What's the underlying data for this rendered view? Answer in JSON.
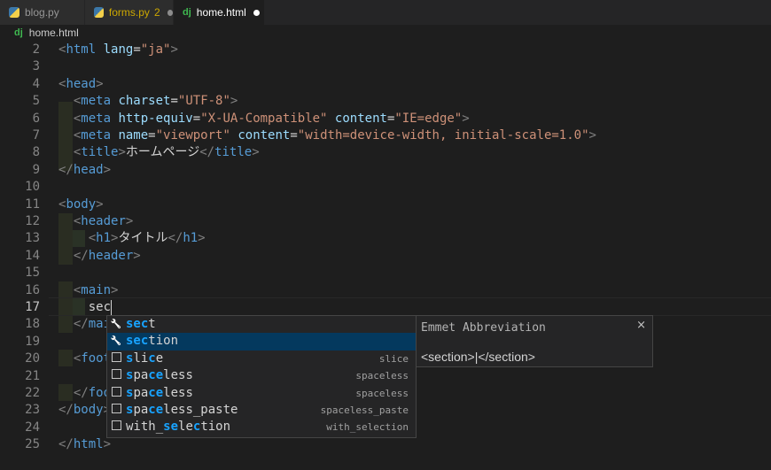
{
  "tabs": [
    {
      "label": "blog.py",
      "icon": "python-icon",
      "state": "inactive"
    },
    {
      "label": "forms.py",
      "badge": "2",
      "icon": "python-icon",
      "state": "inactive",
      "modified": true
    },
    {
      "label": "home.html",
      "icon": "django-icon",
      "state": "active",
      "modified": true
    }
  ],
  "breadcrumb": {
    "icon_text": "dj",
    "file": "home.html"
  },
  "tab_icon_text": "dj",
  "lines": [
    {
      "n": "2",
      "parts": [
        [
          "t",
          "<"
        ],
        [
          "tg",
          "html"
        ],
        [
          "tx",
          " "
        ],
        [
          "at",
          "lang"
        ],
        [
          "tx",
          "="
        ],
        [
          "st",
          "\"ja\""
        ],
        [
          "t",
          ">"
        ]
      ]
    },
    {
      "n": "3",
      "parts": []
    },
    {
      "n": "4",
      "parts": [
        [
          "t",
          "<"
        ],
        [
          "tg",
          "head"
        ],
        [
          "t",
          ">"
        ]
      ]
    },
    {
      "n": "5",
      "parts": [
        [
          "tx",
          "  "
        ],
        [
          "t",
          "<"
        ],
        [
          "tg",
          "meta"
        ],
        [
          "tx",
          " "
        ],
        [
          "at",
          "charset"
        ],
        [
          "tx",
          "="
        ],
        [
          "st",
          "\"UTF-8\""
        ],
        [
          "t",
          ">"
        ]
      ]
    },
    {
      "n": "6",
      "parts": [
        [
          "tx",
          "  "
        ],
        [
          "t",
          "<"
        ],
        [
          "tg",
          "meta"
        ],
        [
          "tx",
          " "
        ],
        [
          "at",
          "http-equiv"
        ],
        [
          "tx",
          "="
        ],
        [
          "st",
          "\"X-UA-Compatible\""
        ],
        [
          "tx",
          " "
        ],
        [
          "at",
          "content"
        ],
        [
          "tx",
          "="
        ],
        [
          "st",
          "\"IE=edge\""
        ],
        [
          "t",
          ">"
        ]
      ]
    },
    {
      "n": "7",
      "parts": [
        [
          "tx",
          "  "
        ],
        [
          "t",
          "<"
        ],
        [
          "tg",
          "meta"
        ],
        [
          "tx",
          " "
        ],
        [
          "at",
          "name"
        ],
        [
          "tx",
          "="
        ],
        [
          "st",
          "\"viewport\""
        ],
        [
          "tx",
          " "
        ],
        [
          "at",
          "content"
        ],
        [
          "tx",
          "="
        ],
        [
          "st",
          "\"width=device-width, initial-scale=1.0\""
        ],
        [
          "t",
          ">"
        ]
      ]
    },
    {
      "n": "8",
      "parts": [
        [
          "tx",
          "  "
        ],
        [
          "t",
          "<"
        ],
        [
          "tg",
          "title"
        ],
        [
          "t",
          ">"
        ],
        [
          "tx",
          "ホームページ"
        ],
        [
          "t",
          "</"
        ],
        [
          "tg",
          "title"
        ],
        [
          "t",
          ">"
        ]
      ]
    },
    {
      "n": "9",
      "parts": [
        [
          "t",
          "</"
        ],
        [
          "tg",
          "head"
        ],
        [
          "t",
          ">"
        ]
      ]
    },
    {
      "n": "10",
      "parts": []
    },
    {
      "n": "11",
      "parts": [
        [
          "t",
          "<"
        ],
        [
          "tg",
          "body"
        ],
        [
          "t",
          ">"
        ]
      ]
    },
    {
      "n": "12",
      "parts": [
        [
          "tx",
          "  "
        ],
        [
          "t",
          "<"
        ],
        [
          "tg",
          "header"
        ],
        [
          "t",
          ">"
        ]
      ]
    },
    {
      "n": "13",
      "parts": [
        [
          "tx",
          "    "
        ],
        [
          "t",
          "<"
        ],
        [
          "tg",
          "h1"
        ],
        [
          "t",
          ">"
        ],
        [
          "tx",
          "タイトル"
        ],
        [
          "t",
          "</"
        ],
        [
          "tg",
          "h1"
        ],
        [
          "t",
          ">"
        ]
      ]
    },
    {
      "n": "14",
      "parts": [
        [
          "tx",
          "  "
        ],
        [
          "t",
          "</"
        ],
        [
          "tg",
          "header"
        ],
        [
          "t",
          ">"
        ]
      ]
    },
    {
      "n": "15",
      "parts": []
    },
    {
      "n": "16",
      "parts": [
        [
          "tx",
          "  "
        ],
        [
          "t",
          "<"
        ],
        [
          "tg",
          "main"
        ],
        [
          "t",
          ">"
        ]
      ]
    },
    {
      "n": "17",
      "parts": [
        [
          "tx",
          "    sec"
        ]
      ],
      "current": true
    },
    {
      "n": "18",
      "parts": [
        [
          "tx",
          "  "
        ],
        [
          "t",
          "</"
        ],
        [
          "tg",
          "mai"
        ]
      ]
    },
    {
      "n": "19",
      "parts": []
    },
    {
      "n": "20",
      "parts": [
        [
          "tx",
          "  "
        ],
        [
          "t",
          "<"
        ],
        [
          "tg",
          "foot"
        ]
      ]
    },
    {
      "n": "21",
      "parts": []
    },
    {
      "n": "22",
      "parts": [
        [
          "tx",
          "  "
        ],
        [
          "t",
          "</"
        ],
        [
          "tg",
          "foo"
        ]
      ]
    },
    {
      "n": "23",
      "parts": [
        [
          "t",
          "</"
        ],
        [
          "tg",
          "body"
        ],
        [
          "t",
          ">"
        ]
      ]
    },
    {
      "n": "24",
      "parts": []
    },
    {
      "n": "25",
      "parts": [
        [
          "t",
          "</"
        ],
        [
          "tg",
          "html"
        ],
        [
          "t",
          ">"
        ]
      ]
    }
  ],
  "suggestions": [
    {
      "icon": "wrench-icon",
      "match": "sec",
      "rest": "t",
      "detail": "",
      "selected": false
    },
    {
      "icon": "wrench-icon",
      "match": "sec",
      "rest": "tion",
      "detail": "",
      "selected": true
    },
    {
      "icon": "snippet-icon",
      "label_html": [
        [
          "hl",
          "s"
        ],
        [
          "",
          "li"
        ],
        [
          "hl",
          "c"
        ],
        [
          "",
          "e"
        ]
      ],
      "detail": "slice",
      "selected": false
    },
    {
      "icon": "snippet-icon",
      "label_html": [
        [
          "hl",
          "s"
        ],
        [
          "",
          "pa"
        ],
        [
          "hl",
          "ce"
        ],
        [
          "",
          "less"
        ]
      ],
      "detail": "spaceless",
      "selected": false
    },
    {
      "icon": "snippet-icon",
      "label_html": [
        [
          "hl",
          "s"
        ],
        [
          "",
          "pa"
        ],
        [
          "hl",
          "ce"
        ],
        [
          "",
          "less"
        ]
      ],
      "detail": "spaceless",
      "selected": false
    },
    {
      "icon": "snippet-icon",
      "label_html": [
        [
          "hl",
          "s"
        ],
        [
          "",
          "pa"
        ],
        [
          "hl",
          "ce"
        ],
        [
          "",
          "less_paste"
        ]
      ],
      "detail": "spaceless_paste",
      "selected": false
    },
    {
      "icon": "snippet-icon",
      "label_html": [
        [
          "",
          "with_"
        ],
        [
          "hl",
          "se"
        ],
        [
          "",
          "le"
        ],
        [
          "hl",
          "c"
        ],
        [
          "",
          "tion"
        ]
      ],
      "detail": "with_selection",
      "selected": false
    }
  ],
  "docs": {
    "title": "Emmet Abbreviation",
    "close": "×",
    "body": "<section>|</section>"
  },
  "colors": {
    "selected_bg": "#04395e",
    "match_highlight": "#18a3ff",
    "modified_dot_inactive": "#8c8c8c",
    "modified_dot_active": "#ffffff",
    "forms_label": "#cca700"
  }
}
